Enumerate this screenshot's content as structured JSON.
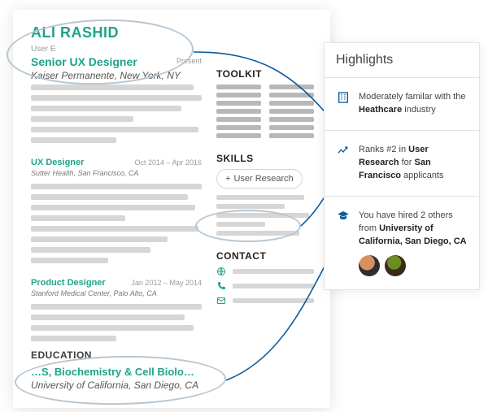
{
  "resume": {
    "name": "ALI RASHID",
    "subtitle_placeholder": "User E",
    "headline_role": "Senior UX Designer",
    "headline_company": "Kaiser Permanente, New York, NY",
    "headline_dates_fragment": "Present",
    "jobs": [
      {
        "title": "UX Designer",
        "dates": "Oct 2014 – Apr 2016",
        "subtitle": "Sutter Health, San Francisco, CA"
      },
      {
        "title": "Product Designer",
        "dates": "Jan 2012 – May 2014",
        "subtitle": "Stanford Medical Center, Palo Alto, CA"
      }
    ],
    "education_heading": "EDUCATION",
    "education_degree_fragment": "…S, Biochemistry & Cell Biolo…",
    "education_school": "University of California, San Diego, CA",
    "toolkit_heading": "TOOLKIT",
    "skills_heading": "SKILLS",
    "skill_pill": "User Research",
    "skill_pill_prefix": "+",
    "contact_heading": "CONTACT"
  },
  "highlights": {
    "title": "Highlights",
    "items": [
      {
        "icon": "building-icon",
        "html": "Moderately familar with the <b>Heathcare</b> industry"
      },
      {
        "icon": "trend-icon",
        "html": "Ranks #2 in <b>User Research</b> for <b>San Francisco</b> applicants"
      },
      {
        "icon": "graduation-icon",
        "html": "You have hired 2 others from <b>University of California, San Diego, CA</b>",
        "avatars": 2
      }
    ]
  },
  "colors": {
    "accent": "#1fa38c",
    "connector": "#0a5a9e",
    "avatar1a": "#d98f5f",
    "avatar1b": "#2e2e2e",
    "avatar2a": "#6b8e23",
    "avatar2b": "#3a2a1a"
  }
}
